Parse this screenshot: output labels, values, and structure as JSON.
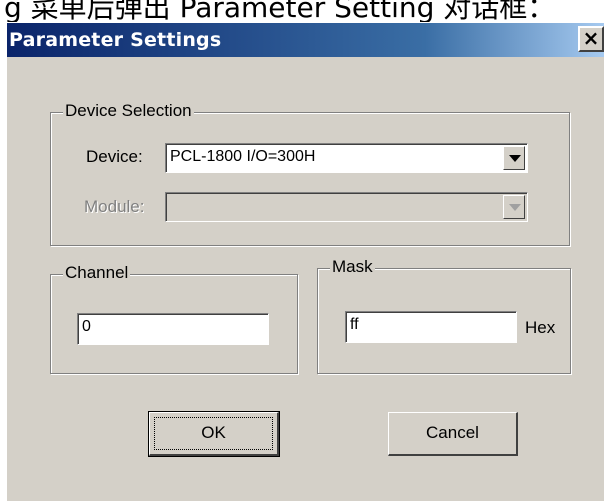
{
  "caption": "g 菜单后弹出 Parameter Setting 对话框：",
  "window": {
    "title": "Parameter Settings",
    "close_glyph": "×"
  },
  "device_selection": {
    "legend": "Device Selection",
    "device_label": "Device:",
    "device_value": "PCL-1800 I/O=300H",
    "module_label": "Module:",
    "module_value": ""
  },
  "channel": {
    "legend": "Channel",
    "value": "0"
  },
  "mask": {
    "legend": "Mask",
    "value": "ff",
    "unit": "Hex"
  },
  "buttons": {
    "ok": "OK",
    "cancel": "Cancel"
  }
}
